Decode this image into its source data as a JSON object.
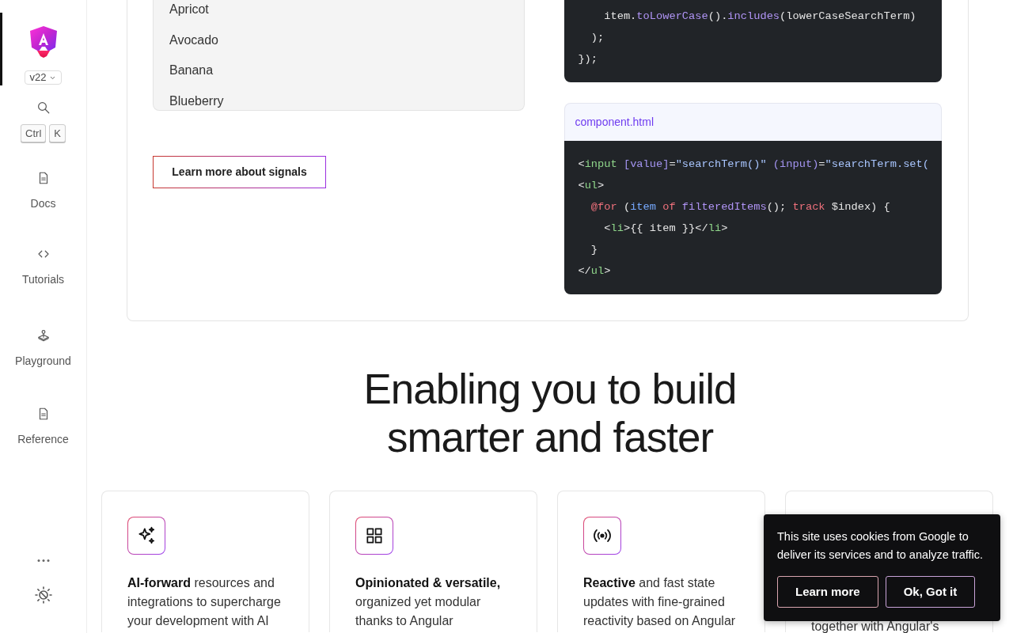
{
  "sidebar": {
    "home": {
      "selected": true
    },
    "version": "v22",
    "shortcut_keys": [
      "Ctrl",
      "K"
    ],
    "items": [
      {
        "label": "Docs",
        "selected": false
      },
      {
        "label": "Tutorials",
        "selected": false
      },
      {
        "label": "Playground",
        "selected": false
      },
      {
        "label": "Reference",
        "selected": false
      }
    ]
  },
  "example": {
    "list_items": [
      "Apricot",
      "Avocado",
      "Banana",
      "Blueberry"
    ],
    "button": "Learn more about signals",
    "code_blocks": [
      {
        "lines": [
          [
            {
              "text": "    item.",
              "kind": "plain"
            },
            {
              "text": "toLowerCase",
              "kind": "method"
            },
            {
              "text": "().",
              "kind": "plain"
            },
            {
              "text": "includes",
              "kind": "method"
            },
            {
              "text": "(lowerCaseSearchTerm)",
              "kind": "plain"
            }
          ],
          [
            {
              "text": "  );",
              "kind": "plain"
            }
          ],
          [
            {
              "text": "});",
              "kind": "plain"
            }
          ]
        ]
      },
      {
        "filename": "component.html",
        "lines": [
          [
            {
              "text": "<",
              "kind": "plain"
            },
            {
              "text": "input",
              "kind": "tag"
            },
            {
              "text": " [value]",
              "kind": "attr"
            },
            {
              "text": "=",
              "kind": "plain"
            },
            {
              "text": "\"searchTerm()\"",
              "kind": "string"
            },
            {
              "text": " (input)",
              "kind": "attr"
            },
            {
              "text": "=",
              "kind": "plain"
            },
            {
              "text": "\"searchTerm.set(",
              "kind": "string"
            }
          ],
          [
            {
              "text": "<",
              "kind": "plain"
            },
            {
              "text": "ul",
              "kind": "tag"
            },
            {
              "text": ">",
              "kind": "plain"
            }
          ],
          [
            {
              "text": "  @for",
              "kind": "keyword"
            },
            {
              "text": " (",
              "kind": "plain"
            },
            {
              "text": "item",
              "kind": "var"
            },
            {
              "text": " of",
              "kind": "keyword"
            },
            {
              "text": " filteredItems",
              "kind": "method"
            },
            {
              "text": "(); ",
              "kind": "plain"
            },
            {
              "text": "track",
              "kind": "keyword"
            },
            {
              "text": " $index) {",
              "kind": "plain"
            }
          ],
          [
            {
              "text": "    <",
              "kind": "plain"
            },
            {
              "text": "li",
              "kind": "tag"
            },
            {
              "text": ">{{ item }}</",
              "kind": "plain"
            },
            {
              "text": "li",
              "kind": "tag"
            },
            {
              "text": ">",
              "kind": "plain"
            }
          ],
          [
            {
              "text": "  }",
              "kind": "plain"
            }
          ],
          [
            {
              "text": "</",
              "kind": "plain"
            },
            {
              "text": "ul",
              "kind": "tag"
            },
            {
              "text": ">",
              "kind": "plain"
            }
          ]
        ]
      }
    ]
  },
  "heading": "Enabling you to build smarter and faster",
  "features": [
    {
      "kind": "feature",
      "text": "**AI-forward** resources and integrations to supercharge your development with AI"
    },
    {
      "kind": "feature",
      "text": "**Opinionated & versatile,** organized yet modular thanks to Angular"
    },
    {
      "kind": "feature",
      "text": "**Reactive** and fast state updates with fine-grained reactivity based on Angular"
    },
    {
      "kind": "partial",
      "text": "together with Angular's"
    }
  ],
  "cookie_banner": {
    "text": "This site uses cookies from Google to deliver its services and to analyze traffic.",
    "buttons": [
      "Learn more",
      "Ok, Got it"
    ]
  }
}
